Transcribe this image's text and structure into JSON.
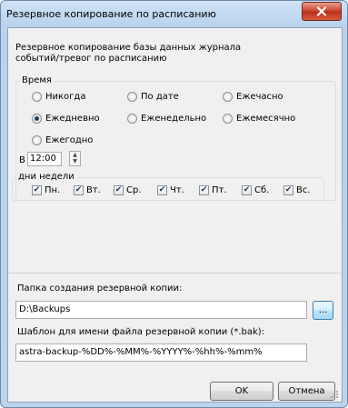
{
  "window": {
    "title": "Резервное копирование по расписанию"
  },
  "description": [
    "Резервное копирование базы данных журнала",
    "событий/тревог по расписанию"
  ],
  "schedule": {
    "group_label": "Время",
    "options": [
      {
        "label": "Никогда",
        "selected": false
      },
      {
        "label": "По дате",
        "selected": false
      },
      {
        "label": "Ежечасно",
        "selected": false
      },
      {
        "label": "Ежедневно",
        "selected": true
      },
      {
        "label": "Еженедельно",
        "selected": false
      },
      {
        "label": "Ежемесячно",
        "selected": false
      },
      {
        "label": "Ежегодно",
        "selected": false
      }
    ],
    "time_label": "В",
    "time_value": "12:00",
    "weekdays_label": "дни недели",
    "weekdays": [
      {
        "label": "Пн.",
        "checked": true
      },
      {
        "label": "Вт.",
        "checked": true
      },
      {
        "label": "Ср.",
        "checked": true
      },
      {
        "label": "Чт.",
        "checked": true
      },
      {
        "label": "Пт.",
        "checked": true
      },
      {
        "label": "Сб.",
        "checked": true
      },
      {
        "label": "Вс.",
        "checked": true
      }
    ]
  },
  "backup_folder": {
    "label": "Папка создания резервной копии:",
    "value": "D:\\Backups",
    "browse_label": "..."
  },
  "filename_template": {
    "label": "Шаблон для имени файла резервной копии (*.bak):",
    "value": "astra-backup-%DD%-%MM%-%YYYY%-%hh%-%mm%"
  },
  "buttons": {
    "ok": "OK",
    "cancel": "Отмена"
  },
  "colors": {
    "close_button": "#c9402a",
    "titlebar": "#cfe2f5",
    "dialog_bg": "#f0f0f0",
    "check_mark": "#1f3f6a"
  }
}
